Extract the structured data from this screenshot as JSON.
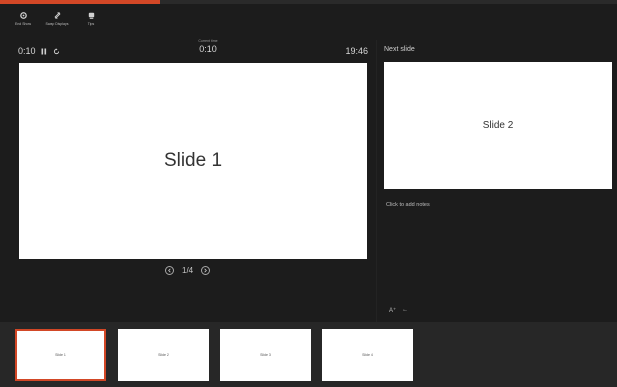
{
  "progress": {
    "fraction": 0.26,
    "accent": "#d24726"
  },
  "toolbar": {
    "items": [
      {
        "label": "End Show",
        "icon": "gear-icon"
      },
      {
        "label": "Swap Displays",
        "icon": "swap-icon"
      },
      {
        "label": "Tips",
        "icon": "lightbulb-icon"
      }
    ]
  },
  "timer": {
    "elapsed": "0:10",
    "center_caption": "Current time",
    "center_value": "0:10",
    "clock": "19:46"
  },
  "current_slide": {
    "title": "Slide 1"
  },
  "navigation": {
    "indicator": "1/4"
  },
  "next_panel": {
    "label": "Next slide",
    "title": "Slide 2"
  },
  "notes": {
    "placeholder": "Click to add notes",
    "font_tool": "A⁺",
    "other_tool": "←"
  },
  "filmstrip": {
    "slides": [
      {
        "label": "Slide 1",
        "active": true
      },
      {
        "label": "Slide 2",
        "active": false
      },
      {
        "label": "Slide 3",
        "active": false
      },
      {
        "label": "Slide 4",
        "active": false
      }
    ]
  }
}
